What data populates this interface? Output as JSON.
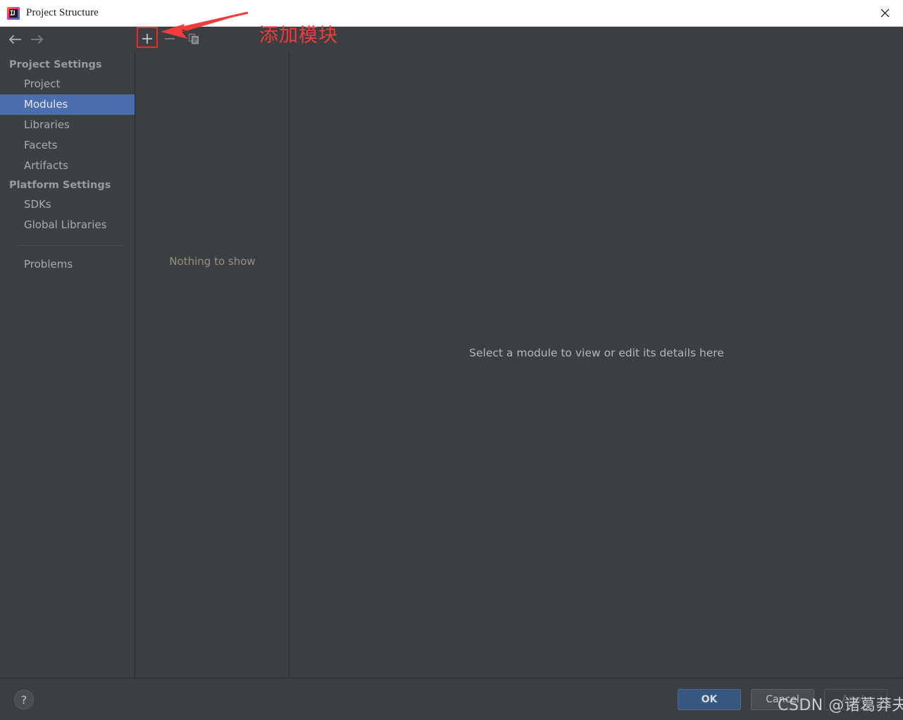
{
  "window": {
    "title": "Project Structure",
    "app_icon": "intellij-idea-icon",
    "close_label": "✕"
  },
  "toolbar": {
    "back_icon": "arrow-left-icon",
    "forward_icon": "arrow-right-icon",
    "add_icon": "plus-icon",
    "remove_icon": "minus-icon",
    "copy_icon": "copy-icon"
  },
  "annotation": {
    "text": "添加模块",
    "color": "#f33b3b",
    "highlight_color": "#ef2b2b"
  },
  "sidebar": {
    "groups": [
      {
        "label": "Project Settings",
        "items": [
          {
            "label": "Project",
            "selected": false
          },
          {
            "label": "Modules",
            "selected": true
          },
          {
            "label": "Libraries",
            "selected": false
          },
          {
            "label": "Facets",
            "selected": false
          },
          {
            "label": "Artifacts",
            "selected": false
          }
        ]
      },
      {
        "label": "Platform Settings",
        "items": [
          {
            "label": "SDKs",
            "selected": false
          },
          {
            "label": "Global Libraries",
            "selected": false
          }
        ]
      }
    ],
    "extra": [
      {
        "label": "Problems",
        "selected": false
      }
    ],
    "selection_color": "#4b6eaf"
  },
  "modules_panel": {
    "empty_text": "Nothing to show"
  },
  "details_panel": {
    "hint_text": "Select a module to view or edit its details here"
  },
  "footer": {
    "help_icon": "question-mark-icon",
    "help_label": "?",
    "buttons": {
      "ok": "OK",
      "cancel": "Cancel",
      "apply": "Apply"
    },
    "ok_color": "#365880"
  },
  "watermark": {
    "text": "CSDN @诸葛莽夫q"
  }
}
